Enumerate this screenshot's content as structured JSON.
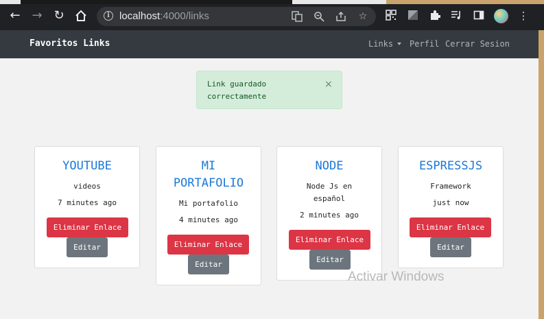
{
  "browser": {
    "url_host": "localhost",
    "url_path": ":4000/links",
    "icons": {
      "back": "arrow-left-icon",
      "forward": "arrow-right-icon",
      "reload": "reload-icon",
      "home": "home-icon",
      "info": "info-icon",
      "translate": "translate-icon",
      "zoom": "zoom-icon",
      "share": "share-icon",
      "bookmark": "star-icon",
      "qr": "qr-code-icon",
      "extension_a": "screenshot-extension-icon",
      "puzzle": "extensions-puzzle-icon",
      "media": "media-control-icon",
      "sidepanel": "side-panel-icon",
      "profile": "profile-avatar",
      "menu": "kebab-menu-icon"
    }
  },
  "navbar": {
    "brand": "Favoritos Links",
    "links": [
      "Links",
      "Perfil",
      "Cerrar Sesion"
    ]
  },
  "alert": {
    "line1": "Link guardado",
    "line2": "correctamente",
    "close": "×"
  },
  "cards": [
    {
      "title_lines": [
        "YOUTUBE"
      ],
      "description_lines": [
        "videos"
      ],
      "time": "7 minutes ago",
      "delete_label": "Eliminar Enlace",
      "edit_label": "Editar"
    },
    {
      "title_lines": [
        "MI",
        "PORTAFOLIO"
      ],
      "description_lines": [
        "Mi portafolio"
      ],
      "time": "4 minutes ago",
      "delete_label": "Eliminar Enlace",
      "edit_label": "Editar"
    },
    {
      "title_lines": [
        "NODE"
      ],
      "description_lines": [
        "Node Js en",
        "español"
      ],
      "time": "2 minutes ago",
      "delete_label": "Eliminar Enlace",
      "edit_label": "Editar"
    },
    {
      "title_lines": [
        "ESPRESSJS"
      ],
      "description_lines": [
        "Framework"
      ],
      "time": "just now",
      "delete_label": "Eliminar Enlace",
      "edit_label": "Editar"
    }
  ],
  "watermark": "Activar Windows",
  "colors": {
    "navbar": "#343a40",
    "title": "#1a78d8",
    "danger": "#dc3545",
    "secondary": "#6c757d",
    "success_bg": "#d4edda"
  }
}
